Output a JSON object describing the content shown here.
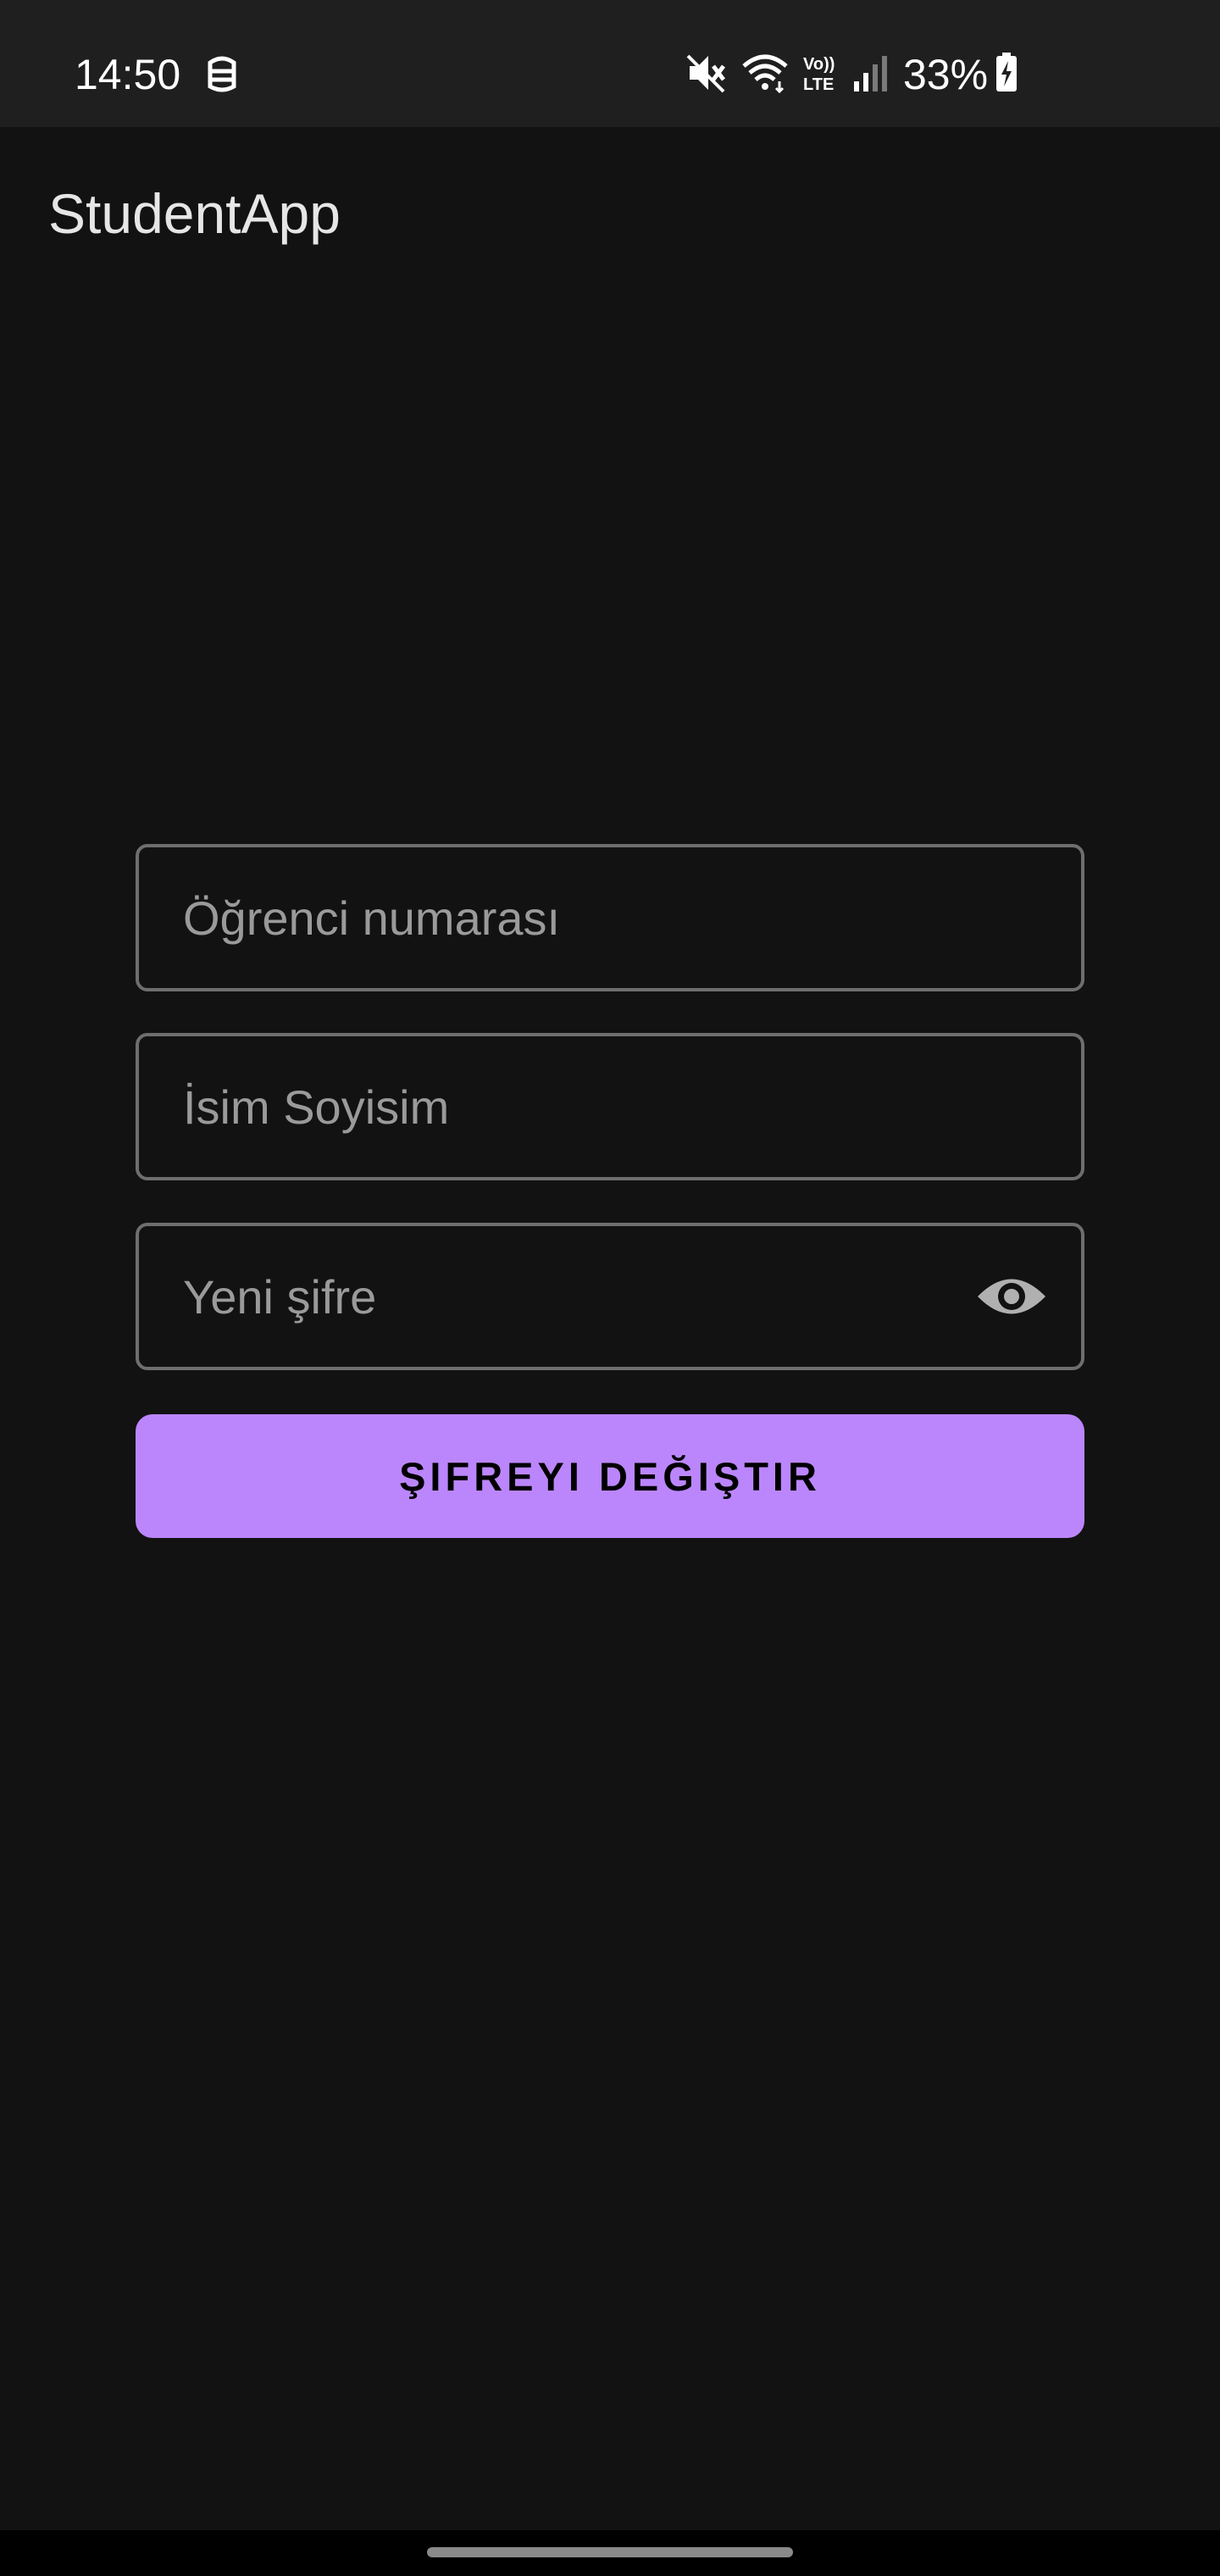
{
  "status_bar": {
    "time": "14:50",
    "battery_percent": "33%",
    "icons": [
      "notification-mask-icon",
      "mute-icon",
      "wifi-icon",
      "volte-icon",
      "signal-icon",
      "battery-charging-icon"
    ]
  },
  "app_bar": {
    "title": "StudentApp"
  },
  "form": {
    "student_number": {
      "placeholder": "Öğrenci numarası",
      "value": ""
    },
    "full_name": {
      "placeholder": "İsim Soyisim",
      "value": ""
    },
    "new_password": {
      "placeholder": "Yeni şifre",
      "value": "",
      "toggle_icon": "eye-icon"
    },
    "submit_label": "ŞIFREYI DEĞIŞTIR"
  },
  "colors": {
    "background": "#121212",
    "status_bar": "#1f1f1f",
    "accent": "#bb86fc",
    "outline": "#6e6e6e",
    "placeholder": "#9a9a9a"
  }
}
